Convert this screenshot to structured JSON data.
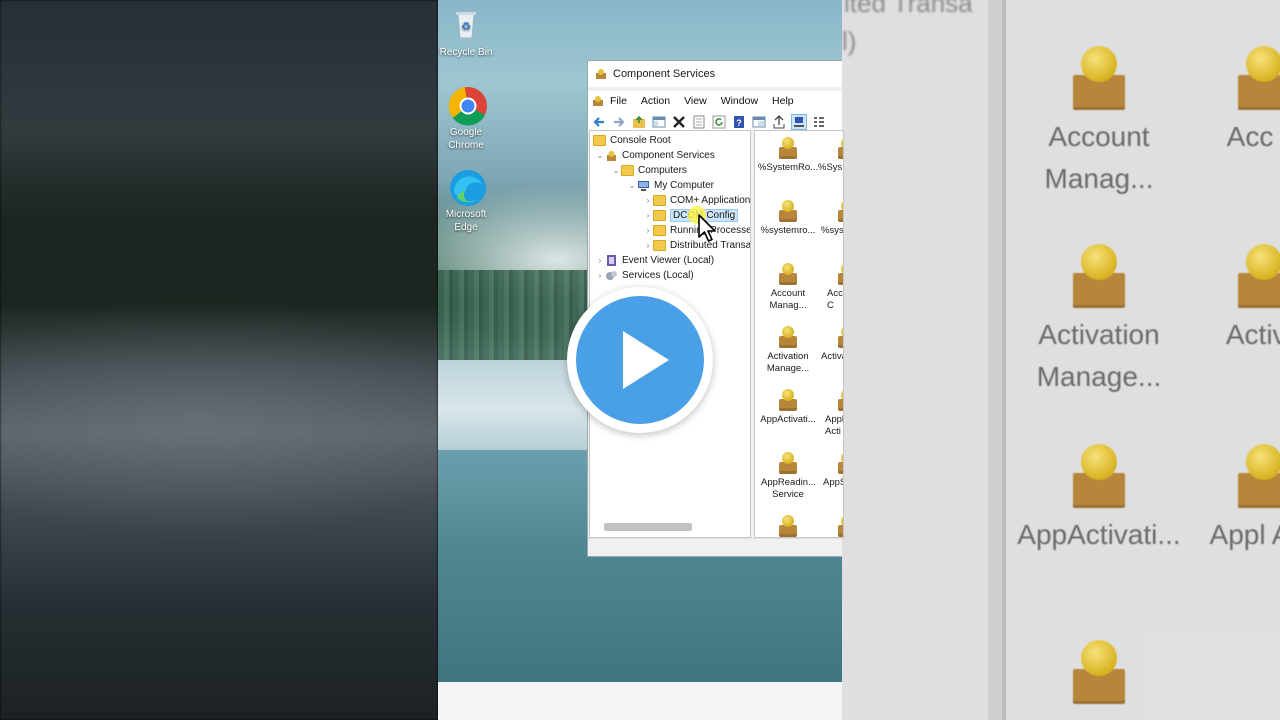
{
  "window": {
    "title": "Component Services",
    "menu": [
      "File",
      "Action",
      "View",
      "Window",
      "Help"
    ]
  },
  "desktop_icons": [
    {
      "label": "Recycle Bin",
      "icon": "recycle-bin-icon"
    },
    {
      "label": "Google Chrome",
      "icon": "chrome-icon"
    },
    {
      "label": "Microsoft Edge",
      "icon": "edge-icon"
    }
  ],
  "toolbar_icons": [
    "back-icon",
    "forward-icon",
    "up-folder-icon",
    "show-hide-tree-icon",
    "delete-icon",
    "properties-icon",
    "refresh-icon",
    "help-icon",
    "console-window-icon",
    "export-icon",
    "large-icons-view-icon",
    "small-icons-view-icon"
  ],
  "tree": [
    {
      "label": "Console Root",
      "expanded": true
    },
    {
      "label": "Component Services",
      "expanded": true
    },
    {
      "label": "Computers",
      "expanded": true
    },
    {
      "label": "My Computer",
      "expanded": true
    },
    {
      "label": "COM+ Applications",
      "expanded": false
    },
    {
      "label": "DCOM Config",
      "expanded": false,
      "selected": true
    },
    {
      "label": "Running Processes",
      "expanded": false
    },
    {
      "label": "Distributed Transaction Coordinator",
      "expanded": false
    },
    {
      "label": "Event Viewer (Local)",
      "expanded": false
    },
    {
      "label": "Services (Local)",
      "expanded": false
    }
  ],
  "list_items": [
    {
      "label": "%SystemRo..."
    },
    {
      "label": "%Sys"
    },
    {
      "label": "%systemro..."
    },
    {
      "label": "%sys"
    },
    {
      "label": "Account Manag..."
    },
    {
      "label": "Acc C"
    },
    {
      "label": "Activation Manage..."
    },
    {
      "label": "Activa"
    },
    {
      "label": "AppActivati..."
    },
    {
      "label": "Appl Acti"
    },
    {
      "label": "AppReadin... Service"
    },
    {
      "label": "AppS"
    },
    {
      "label": ""
    },
    {
      "label": ""
    }
  ],
  "zoomed_right": {
    "top_text": "ited Transa",
    "top_text2": "l)",
    "items": [
      {
        "label": "Account Manag..."
      },
      {
        "label": "Acc C"
      },
      {
        "label": "Activation Manage..."
      },
      {
        "label": "Activa"
      },
      {
        "label": "AppActivati..."
      },
      {
        "label": "Appl Acti"
      }
    ]
  },
  "overlay": {
    "play_button": "play-icon"
  },
  "colors": {
    "play_blue": "#4aa0e6",
    "folder_yellow": "#f2c94c",
    "selection": "#cce4f7"
  }
}
